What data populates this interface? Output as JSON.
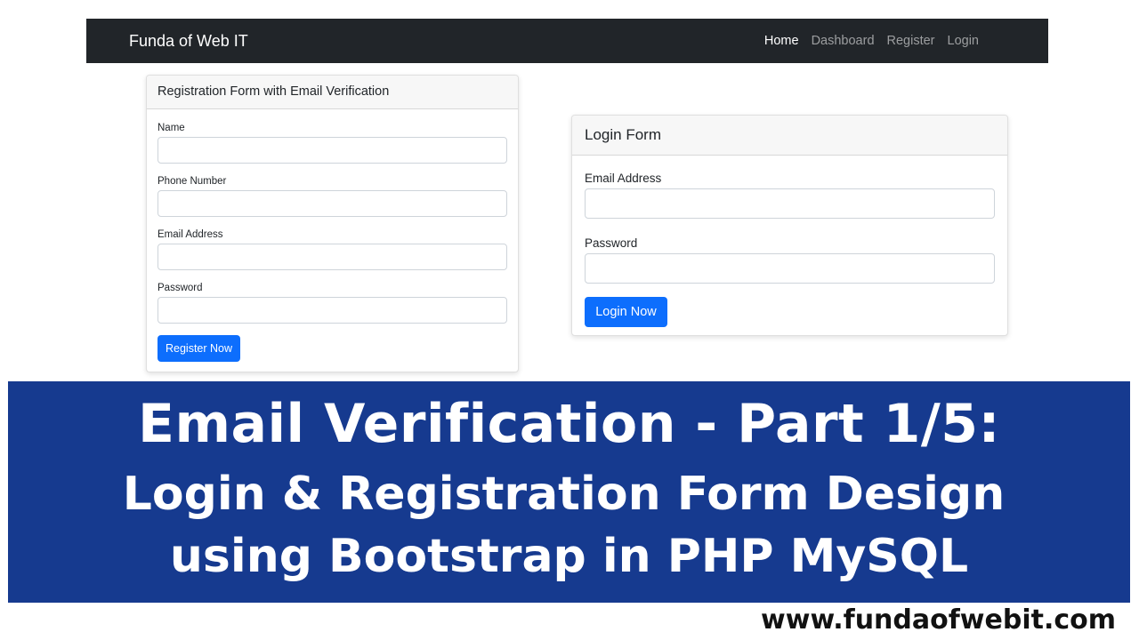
{
  "navbar": {
    "brand": "Funda of Web IT",
    "links": [
      {
        "label": "Home",
        "active": true
      },
      {
        "label": "Dashboard",
        "active": false
      },
      {
        "label": "Register",
        "active": false
      },
      {
        "label": "Login",
        "active": false
      }
    ]
  },
  "registration_form": {
    "title": "Registration Form with Email Verification",
    "fields": [
      {
        "label": "Name",
        "value": ""
      },
      {
        "label": "Phone Number",
        "value": ""
      },
      {
        "label": "Email Address",
        "value": ""
      },
      {
        "label": "Password",
        "value": ""
      }
    ],
    "submit_label": "Register Now"
  },
  "login_form": {
    "title": "Login Form",
    "fields": [
      {
        "label": "Email Address",
        "value": ""
      },
      {
        "label": "Password",
        "value": ""
      }
    ],
    "submit_label": "Login Now"
  },
  "banner": {
    "line1": "Email Verification - Part 1/5:",
    "line2": "Login & Registration Form Design",
    "line3": "using Bootstrap in PHP MySQL"
  },
  "site_url": "www.fundaofwebit.com",
  "colors": {
    "navbar_bg": "#212529",
    "primary_button": "#0d6efd",
    "banner_bg": "#163a8f"
  }
}
